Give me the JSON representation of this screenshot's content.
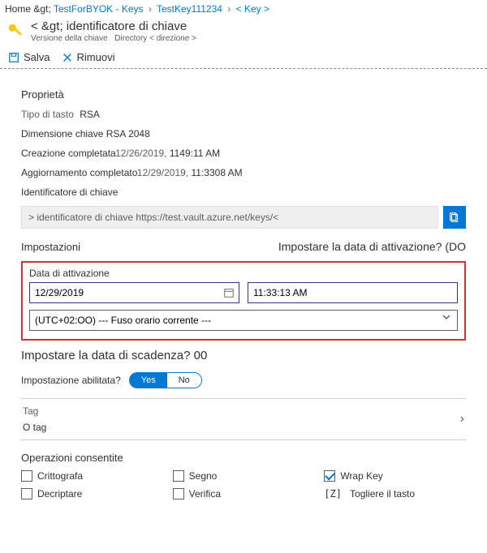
{
  "breadcrumb": {
    "home": "Home &gt;",
    "seg1": "TestForBYOK - Keys",
    "seg2": "TestKey111234",
    "seg3": "< Key >"
  },
  "header": {
    "title": "< &gt; identificatore di chiave",
    "subline_version": "Versione della chiave",
    "subline_dir": "Directory < direzione >"
  },
  "toolbar": {
    "save": "Salva",
    "remove": "Rimuovi"
  },
  "props": {
    "heading": "Proprietà",
    "type_label": "Tipo di tasto",
    "type_value": "RSA",
    "size_line": "Dimensione chiave RSA 2048",
    "created_label": "Creazione completata",
    "created_date": "12/26/2019,",
    "created_time": "1149:11 AM",
    "updated_label": "Aggiornamento completato",
    "updated_date": "12/29/2019,",
    "updated_time": "11:3308 AM",
    "ident_label": "Identificatore di chiave",
    "ident_value": "> identificatore di chiave https://test.vault.azure.net/keys/<"
  },
  "settings": {
    "heading": "Impostazioni",
    "activation_q": "Impostare la data di attivazione? (DO",
    "activation_label": "Data di attivazione",
    "activation_date": "12/29/2019",
    "activation_time": "11:33:13 AM",
    "timezone": "(UTC+02:OO) --- Fuso orario corrente ---",
    "expiry_q": "Impostare la data di scadenza? 00",
    "enabled_label": "Impostazione abilitata?",
    "enabled_yes": "Yes",
    "enabled_no": "No"
  },
  "tag": {
    "label": "Tag",
    "value": "O tag"
  },
  "ops": {
    "heading": "Operazioni consentite",
    "encrypt": "Crittografa",
    "sign": "Segno",
    "wrap": "Wrap Key",
    "decrypt": "Decriptare",
    "verify": "Verifica",
    "unwrap_prefix": "[Z]",
    "unwrap": "Togliere il tasto"
  }
}
